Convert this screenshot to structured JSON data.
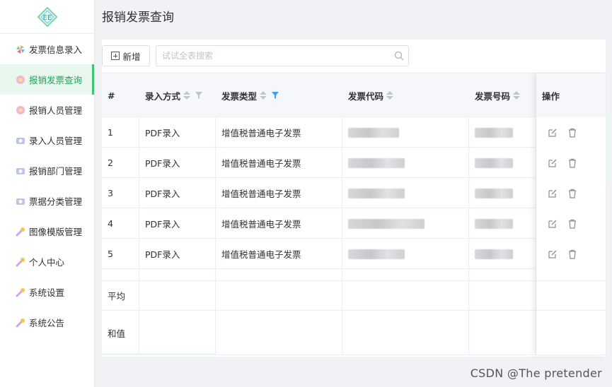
{
  "sidebar": {
    "logo_text": "EE",
    "items": [
      {
        "label": "发票信息录入",
        "icon": "pinwheel-icon",
        "active": false
      },
      {
        "label": "报销发票查询",
        "icon": "flower-icon",
        "active": true
      },
      {
        "label": "报销人员管理",
        "icon": "flower-icon",
        "active": false
      },
      {
        "label": "录入人员管理",
        "icon": "camera-icon",
        "active": false
      },
      {
        "label": "报销部门管理",
        "icon": "camera-icon",
        "active": false
      },
      {
        "label": "票据分类管理",
        "icon": "camera-icon",
        "active": false
      },
      {
        "label": "图像模版管理",
        "icon": "comet-icon",
        "active": false
      },
      {
        "label": "个人中心",
        "icon": "comet-icon",
        "active": false
      },
      {
        "label": "系统设置",
        "icon": "comet-icon",
        "active": false
      },
      {
        "label": "系统公告",
        "icon": "comet-icon",
        "active": false
      }
    ]
  },
  "page": {
    "title": "报销发票查询"
  },
  "toolbar": {
    "add_label": "新增",
    "search_placeholder": "试试全表搜索"
  },
  "table": {
    "headers": {
      "index": "#",
      "entry_method": "录入方式",
      "invoice_type": "发票类型",
      "invoice_code": "发票代码",
      "invoice_number": "发票号码",
      "actions": "操作"
    },
    "rows": [
      {
        "index": "1",
        "entry_method": "PDF录入",
        "invoice_type": "增值税普通电子发票"
      },
      {
        "index": "2",
        "entry_method": "PDF录入",
        "invoice_type": "增值税普通电子发票"
      },
      {
        "index": "3",
        "entry_method": "PDF录入",
        "invoice_type": "增值税普通电子发票"
      },
      {
        "index": "4",
        "entry_method": "PDF录入",
        "invoice_type": "增值税普通电子发票"
      },
      {
        "index": "5",
        "entry_method": "PDF录入",
        "invoice_type": "增值税普通电子发票"
      }
    ],
    "summary": {
      "average_label": "平均",
      "sum_label": "和值"
    }
  },
  "watermark": "CSDN @The  pretender",
  "colors": {
    "accent": "#3ac776",
    "active_bg": "#e9f7ef",
    "filter_active": "#409eff"
  }
}
